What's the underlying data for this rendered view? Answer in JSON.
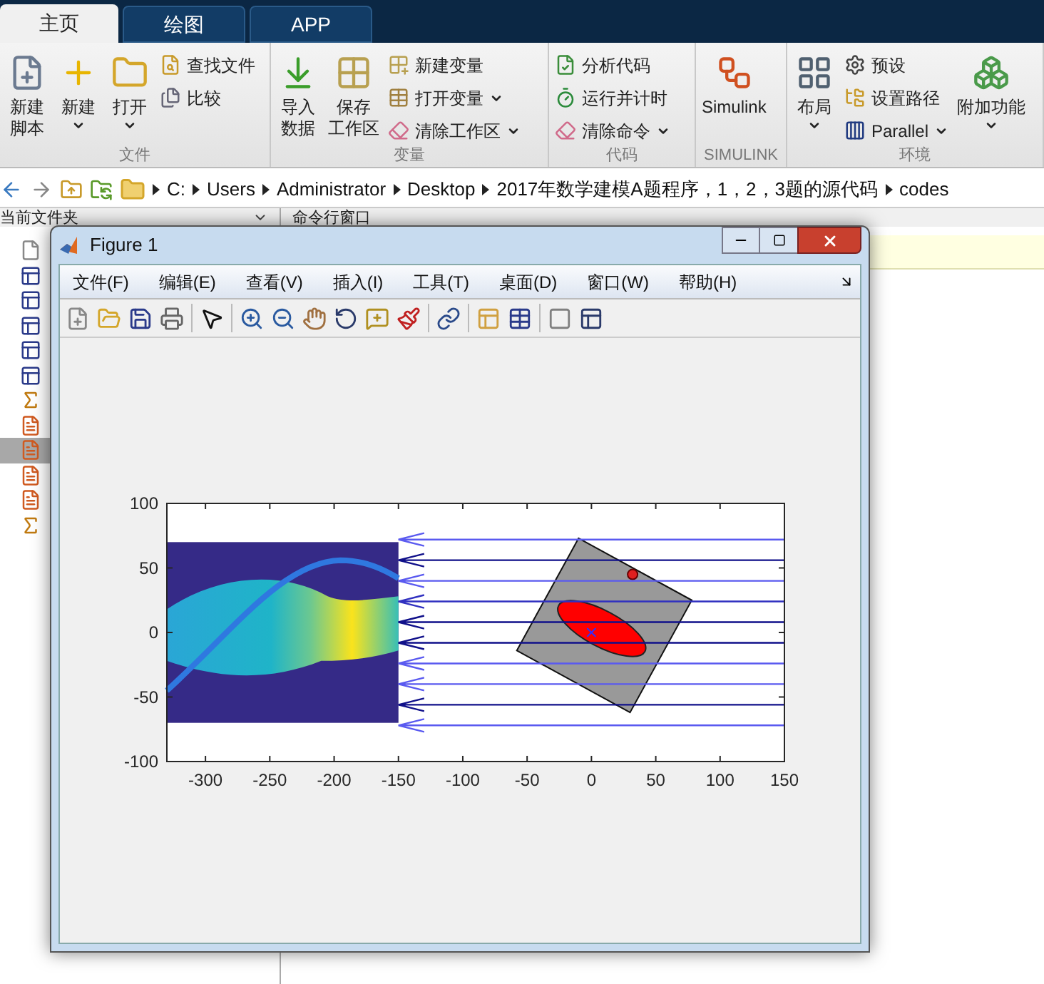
{
  "toolstrip": {
    "tabs": [
      {
        "label": "主页",
        "selected": true
      },
      {
        "label": "绘图",
        "selected": false
      },
      {
        "label": "APP",
        "selected": false
      }
    ],
    "groups": [
      {
        "label": "文件",
        "columns": [
          {
            "items": [
              {
                "kind": "large",
                "lines": [
                  "新建",
                  "脚本"
                ],
                "dropdown": false
              }
            ]
          },
          {
            "items": [
              {
                "kind": "large",
                "lines": [
                  "新建"
                ],
                "dropdown": true
              }
            ]
          },
          {
            "items": [
              {
                "kind": "large",
                "lines": [
                  "打开"
                ],
                "dropdown": true
              }
            ]
          },
          {
            "items": [
              {
                "kind": "small",
                "label": "查找文件",
                "dropdown": false
              },
              {
                "kind": "small",
                "label": "比较",
                "dropdown": false
              }
            ]
          }
        ]
      },
      {
        "label": "变量",
        "columns": [
          {
            "items": [
              {
                "kind": "large",
                "lines": [
                  "导入",
                  "数据"
                ],
                "dropdown": false
              }
            ]
          },
          {
            "items": [
              {
                "kind": "large",
                "lines": [
                  "保存",
                  "工作区"
                ],
                "dropdown": false
              }
            ]
          },
          {
            "items": [
              {
                "kind": "small",
                "label": "新建变量",
                "dropdown": false
              },
              {
                "kind": "small",
                "label": "打开变量",
                "dropdown": true
              },
              {
                "kind": "small",
                "label": "清除工作区",
                "dropdown": true
              }
            ]
          }
        ]
      },
      {
        "label": "代码",
        "columns": [
          {
            "items": [
              {
                "kind": "small",
                "label": "分析代码",
                "dropdown": false
              },
              {
                "kind": "small",
                "label": "运行并计时",
                "dropdown": false
              },
              {
                "kind": "small",
                "label": "清除命令",
                "dropdown": true
              }
            ]
          }
        ]
      },
      {
        "label": "SIMULINK",
        "columns": [
          {
            "items": [
              {
                "kind": "large",
                "lines": [
                  "Simulink"
                ],
                "dropdown": false
              }
            ]
          }
        ]
      },
      {
        "label": "环境",
        "columns": [
          {
            "items": [
              {
                "kind": "large",
                "lines": [
                  "布局"
                ],
                "dropdown": true
              }
            ]
          },
          {
            "items": [
              {
                "kind": "small",
                "label": "预设",
                "dropdown": false
              },
              {
                "kind": "small",
                "label": "设置路径",
                "dropdown": false
              },
              {
                "kind": "small",
                "label": "Parallel",
                "dropdown": true
              }
            ]
          },
          {
            "items": [
              {
                "kind": "large",
                "lines": [
                  "附加功能"
                ],
                "dropdown": true
              }
            ]
          }
        ]
      }
    ]
  },
  "address_bar": {
    "path": [
      "C:",
      "Users",
      "Administrator",
      "Desktop",
      "2017年数学建模A题程序，1，2，3题的源代码",
      "codes"
    ]
  },
  "file_panel": {
    "title": "当前文件夹",
    "files": [
      {
        "kind": "blank",
        "selected": false
      },
      {
        "kind": "figure",
        "selected": false
      },
      {
        "kind": "figure",
        "selected": false
      },
      {
        "kind": "figure",
        "selected": false
      },
      {
        "kind": "figure",
        "selected": false
      },
      {
        "kind": "figure",
        "selected": false
      },
      {
        "kind": "function",
        "selected": false
      },
      {
        "kind": "script",
        "selected": false
      },
      {
        "kind": "script",
        "selected": true
      },
      {
        "kind": "script",
        "selected": false
      },
      {
        "kind": "script",
        "selected": false
      },
      {
        "kind": "function",
        "selected": false
      }
    ]
  },
  "command_window": {
    "title": "命令行窗口"
  },
  "figure": {
    "title": "Figure 1",
    "menus": [
      "文件(F)",
      "编辑(E)",
      "查看(V)",
      "插入(I)",
      "工具(T)",
      "桌面(D)",
      "窗口(W)",
      "帮助(H)"
    ],
    "chart_data": {
      "type": "line",
      "x": [
        -150,
        150
      ],
      "xlim": [
        -330,
        150
      ],
      "ylim": [
        -100,
        100
      ],
      "xticks": [
        -300,
        -250,
        -200,
        -150,
        -100,
        -50,
        0,
        50,
        100,
        150
      ],
      "yticks": [
        -100,
        -50,
        0,
        50,
        100
      ],
      "series": [
        {
          "color": "#5a5af0",
          "values": [
            72,
            72
          ]
        },
        {
          "color": "#10108a",
          "values": [
            56,
            56
          ]
        },
        {
          "color": "#5a5af0",
          "values": [
            40,
            40
          ]
        },
        {
          "color": "#3030c0",
          "values": [
            24,
            24
          ]
        },
        {
          "color": "#10108a",
          "values": [
            8,
            8
          ]
        },
        {
          "color": "#10108a",
          "values": [
            -8,
            -8
          ]
        },
        {
          "color": "#5a5af0",
          "values": [
            -24,
            -24
          ]
        },
        {
          "color": "#5a5af0",
          "values": [
            -40,
            -40
          ]
        },
        {
          "color": "#10108a",
          "values": [
            -56,
            -56
          ]
        },
        {
          "color": "#5a5af0",
          "values": [
            -72,
            -72
          ]
        }
      ]
    }
  }
}
